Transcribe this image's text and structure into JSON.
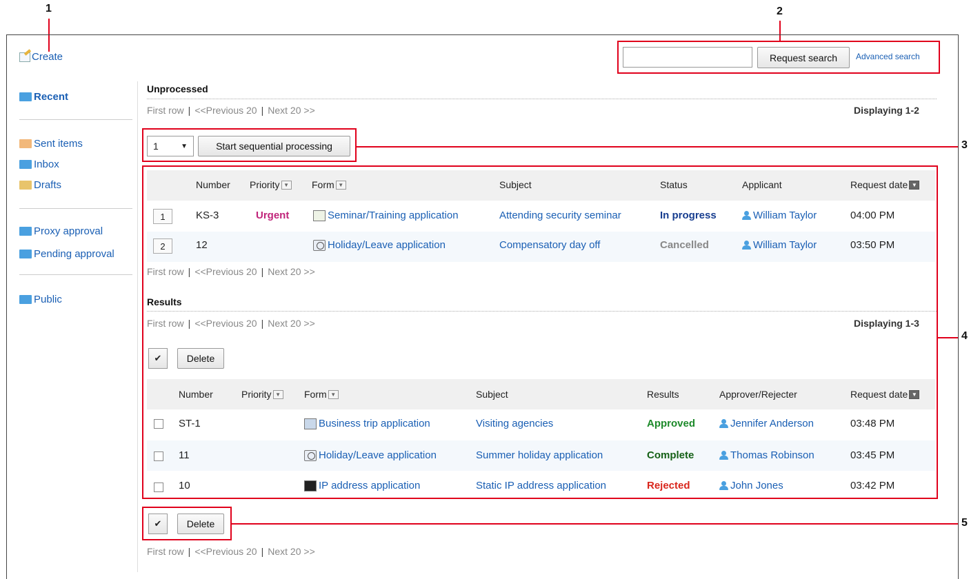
{
  "callouts": [
    "1",
    "2",
    "3",
    "4",
    "5"
  ],
  "header": {
    "create_label": "Create",
    "search_placeholder": "",
    "search_button": "Request search",
    "advanced_search": "Advanced search"
  },
  "sidebar": {
    "items": [
      {
        "label": "Recent"
      },
      {
        "label": "Sent items"
      },
      {
        "label": "Inbox"
      },
      {
        "label": "Drafts"
      },
      {
        "label": "Proxy approval"
      },
      {
        "label": "Pending approval"
      },
      {
        "label": "Public"
      }
    ]
  },
  "pager": {
    "first": "First row",
    "prev": "<<Previous 20",
    "next": "Next 20 >>",
    "sep": "|"
  },
  "unprocessed": {
    "title": "Unprocessed",
    "displaying": "Displaying 1-2",
    "select_value": "1",
    "sequential_button": "Start sequential processing",
    "columns": [
      "Number",
      "Priority",
      "Form",
      "Subject",
      "Status",
      "Applicant",
      "Request date"
    ],
    "rows": [
      {
        "index": "1",
        "number": "KS-3",
        "priority": "Urgent",
        "form": "Seminar/Training application",
        "subject": "Attending security seminar",
        "status": "In progress",
        "applicant": "William Taylor",
        "date": "04:00 PM"
      },
      {
        "index": "2",
        "number": "12",
        "priority": "",
        "form": "Holiday/Leave application",
        "subject": "Compensatory day off",
        "status": "Cancelled",
        "applicant": "William Taylor",
        "date": "03:50 PM"
      }
    ]
  },
  "results": {
    "title": "Results",
    "displaying": "Displaying 1-3",
    "checkall": "✔",
    "delete_button": "Delete",
    "columns": [
      "Number",
      "Priority",
      "Form",
      "Subject",
      "Results",
      "Approver/Rejecter",
      "Request date"
    ],
    "rows": [
      {
        "number": "ST-1",
        "form": "Business trip application",
        "subject": "Visiting agencies",
        "result": "Approved",
        "approver": "Jennifer Anderson",
        "date": "03:48 PM"
      },
      {
        "number": "11",
        "form": "Holiday/Leave application",
        "subject": "Summer holiday application",
        "result": "Complete",
        "approver": "Thomas Robinson",
        "date": "03:45 PM"
      },
      {
        "number": "10",
        "form": "IP address application",
        "subject": "Static IP address application",
        "result": "Rejected",
        "approver": "John Jones",
        "date": "03:42 PM"
      }
    ]
  },
  "colors": {
    "annotation": "#e0001b",
    "link": "#1a5fb4"
  }
}
